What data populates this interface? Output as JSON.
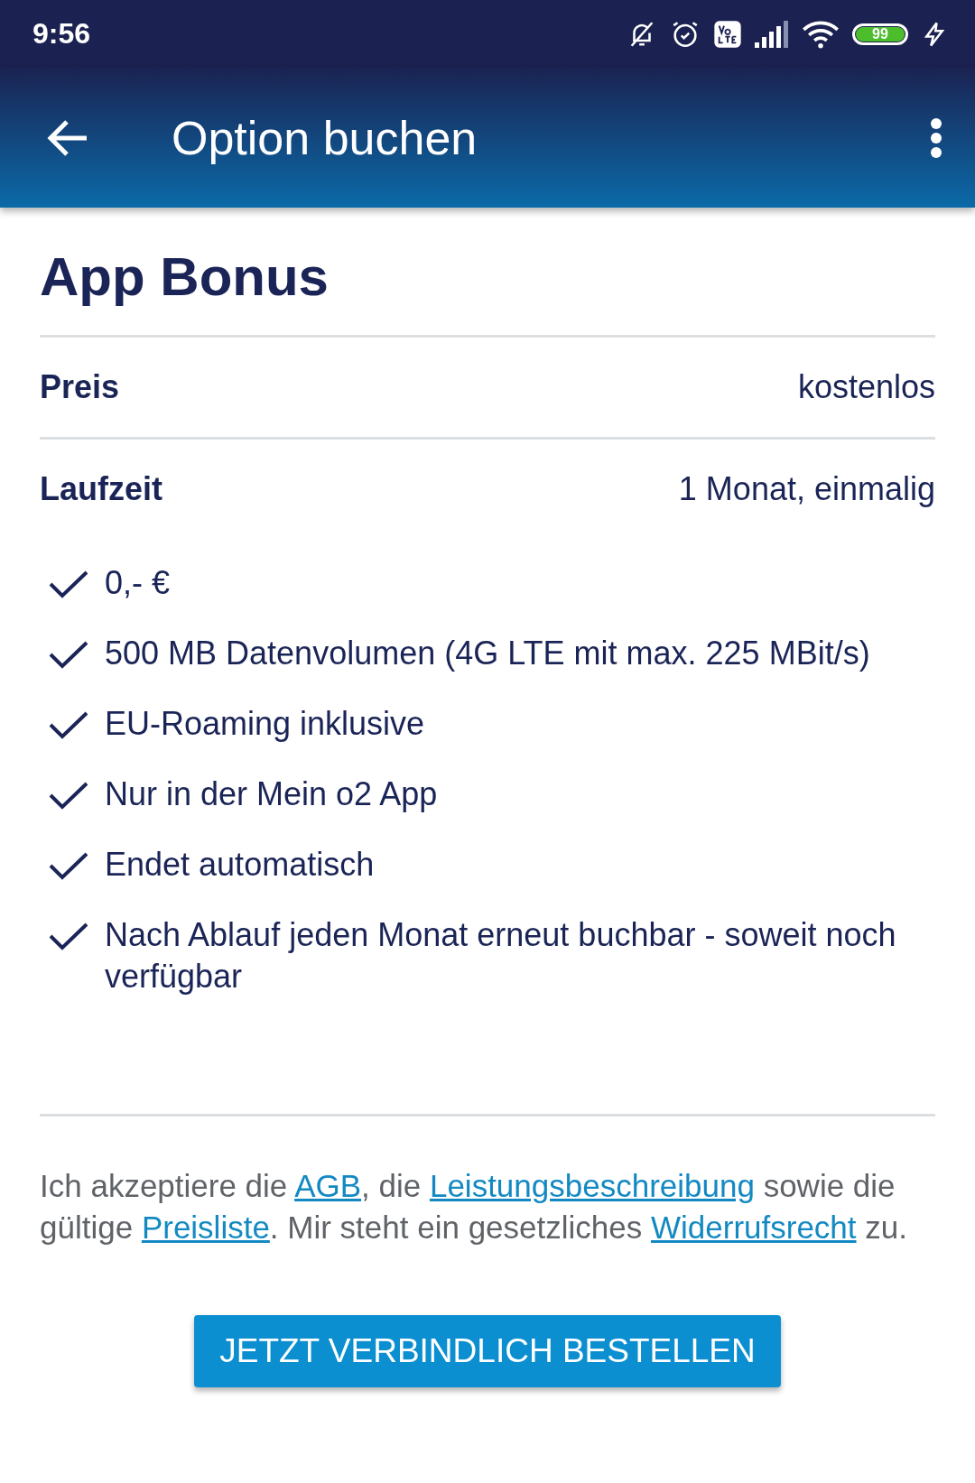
{
  "status_bar": {
    "time": "9:56",
    "battery": "99"
  },
  "app_bar": {
    "title": "Option buchen"
  },
  "option": {
    "title": "App Bonus",
    "details": [
      {
        "label": "Preis",
        "value": "kostenlos"
      },
      {
        "label": "Laufzeit",
        "value": "1 Monat, einmalig"
      }
    ],
    "features": [
      "0,- €",
      "500 MB Datenvolumen (4G LTE mit max. 225 MBit/s)",
      "EU-Roaming inklusive",
      "Nur in der Mein o2 App",
      "Endet automatisch",
      "Nach Ablauf jeden Monat erneut buchbar - soweit noch verfügbar"
    ]
  },
  "consent": [
    {
      "kind": "text",
      "text": "Ich akzeptiere die "
    },
    {
      "kind": "link",
      "text": "AGB"
    },
    {
      "kind": "text",
      "text": ", die "
    },
    {
      "kind": "link",
      "text": "Leistungsbeschreibung"
    },
    {
      "kind": "text",
      "text": " sowie die gültige "
    },
    {
      "kind": "link",
      "text": "Preisliste"
    },
    {
      "kind": "text",
      "text": ". Mir steht ein gesetzliches "
    },
    {
      "kind": "link",
      "text": "Widerrufsrecht"
    },
    {
      "kind": "text",
      "text": " zu."
    }
  ],
  "order_button": "JETZT VERBINDLICH BESTELLEN"
}
